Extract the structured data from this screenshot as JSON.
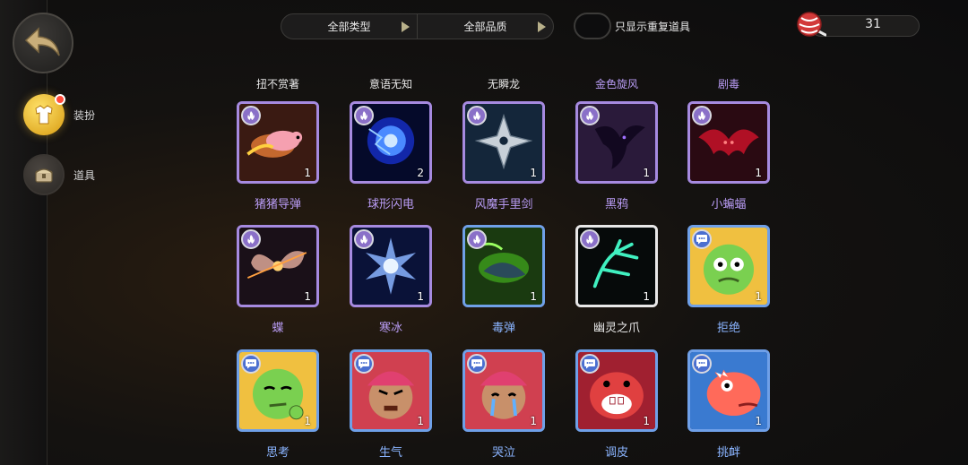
{
  "nav": {
    "items": [
      {
        "label": "装扮",
        "icon": "costume-icon",
        "active": true,
        "has_notification": true
      },
      {
        "label": "道具",
        "icon": "item-chest-icon",
        "active": false,
        "has_notification": false
      }
    ]
  },
  "filters": {
    "type_label": "全部类型",
    "quality_label": "全部品质"
  },
  "toggle": {
    "label": "只显示重复道具",
    "checked": false
  },
  "currency": {
    "value": "31",
    "icon": "lollipop-icon"
  },
  "top_row_labels": [
    "扭不赏著",
    "意语无知",
    "无瞬龙",
    "金色旋风",
    "剧毒"
  ],
  "items": [
    {
      "name": "猪猪导弹",
      "count": "1",
      "rarity": "purple",
      "badge": "flame-icon",
      "art": "pig-missile"
    },
    {
      "name": "球形闪电",
      "count": "2",
      "rarity": "purple",
      "badge": "flame-icon",
      "art": "ball-lightning"
    },
    {
      "name": "风魔手里剑",
      "count": "1",
      "rarity": "purple",
      "badge": "flame-icon",
      "art": "shuriken"
    },
    {
      "name": "黑鸦",
      "count": "1",
      "rarity": "purple",
      "badge": "flame-icon",
      "art": "black-crow"
    },
    {
      "name": "小蝙蝠",
      "count": "1",
      "rarity": "purple",
      "badge": "flame-icon",
      "art": "red-bat"
    },
    {
      "name": "蝶",
      "count": "1",
      "rarity": "purple",
      "badge": "flame-icon",
      "art": "butterfly"
    },
    {
      "name": "寒冰",
      "count": "1",
      "rarity": "purple",
      "badge": "flame-icon",
      "art": "ice"
    },
    {
      "name": "毒弹",
      "count": "1",
      "rarity": "blue",
      "badge": "flame-icon",
      "art": "poison"
    },
    {
      "name": "幽灵之爪",
      "count": "1",
      "rarity": "white",
      "badge": "flame-icon",
      "art": "ghost-claw"
    },
    {
      "name": "拒绝",
      "count": "1",
      "rarity": "blue",
      "badge": "chat-icon",
      "art": "goblin-refuse"
    },
    {
      "name": "思考",
      "count": "1",
      "rarity": "blue",
      "badge": "chat-icon",
      "art": "goblin-think"
    },
    {
      "name": "生气",
      "count": "1",
      "rarity": "blue",
      "badge": "chat-icon",
      "art": "girl-angry"
    },
    {
      "name": "哭泣",
      "count": "1",
      "rarity": "blue",
      "badge": "chat-icon",
      "art": "girl-cry"
    },
    {
      "name": "调皮",
      "count": "1",
      "rarity": "blue",
      "badge": "chat-icon",
      "art": "hippo-naughty"
    },
    {
      "name": "挑衅",
      "count": "1",
      "rarity": "blue",
      "badge": "chat-icon",
      "art": "dino-taunt"
    }
  ],
  "colors": {
    "purple": "#a68ae0",
    "blue": "#6fa0e8",
    "white": "#e8e8e8",
    "active_nav": "#f5c030"
  }
}
